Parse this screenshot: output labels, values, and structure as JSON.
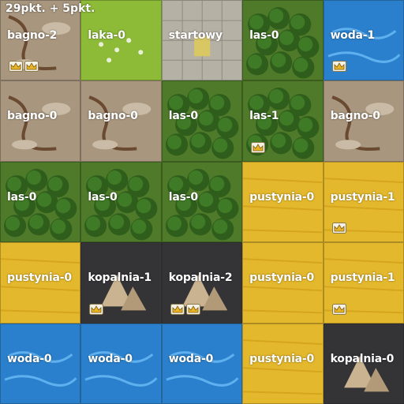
{
  "score": "29pkt. + 5pkt.",
  "colors": {
    "bagno": "#a89680",
    "laka": "#8fbd3a",
    "startowy": "#b9b4a8",
    "las": "#4f7a2a",
    "woda": "#2f86cf",
    "pustynia": "#e6bb2e",
    "kopalnia": "#3b3a3c"
  },
  "grid": [
    [
      {
        "label": "bagno-2",
        "terrain": "bagno",
        "crowns": 2
      },
      {
        "label": "laka-0",
        "terrain": "laka",
        "crowns": 0
      },
      {
        "label": "startowy",
        "terrain": "startowy",
        "crowns": 0
      },
      {
        "label": "las-0",
        "terrain": "las",
        "crowns": 0
      },
      {
        "label": "woda-1",
        "terrain": "woda",
        "crowns": 1
      }
    ],
    [
      {
        "label": "bagno-0",
        "terrain": "bagno",
        "crowns": 0
      },
      {
        "label": "bagno-0",
        "terrain": "bagno",
        "crowns": 0
      },
      {
        "label": "las-0",
        "terrain": "las",
        "crowns": 0
      },
      {
        "label": "las-1",
        "terrain": "las",
        "crowns": 1
      },
      {
        "label": "bagno-0",
        "terrain": "bagno",
        "crowns": 0
      }
    ],
    [
      {
        "label": "las-0",
        "terrain": "las",
        "crowns": 0
      },
      {
        "label": "las-0",
        "terrain": "las",
        "crowns": 0
      },
      {
        "label": "las-0",
        "terrain": "las",
        "crowns": 0
      },
      {
        "label": "pustynia-0",
        "terrain": "pustynia",
        "crowns": 0
      },
      {
        "label": "pustynia-1",
        "terrain": "pustynia",
        "crowns": 1
      }
    ],
    [
      {
        "label": "pustynia-0",
        "terrain": "pustynia",
        "crowns": 0
      },
      {
        "label": "kopalnia-1",
        "terrain": "kopalnia",
        "crowns": 1
      },
      {
        "label": "kopalnia-2",
        "terrain": "kopalnia",
        "crowns": 2
      },
      {
        "label": "pustynia-0",
        "terrain": "pustynia",
        "crowns": 0
      },
      {
        "label": "pustynia-1",
        "terrain": "pustynia",
        "crowns": 1
      }
    ],
    [
      {
        "label": "woda-0",
        "terrain": "woda",
        "crowns": 0
      },
      {
        "label": "woda-0",
        "terrain": "woda",
        "crowns": 0
      },
      {
        "label": "woda-0",
        "terrain": "woda",
        "crowns": 0
      },
      {
        "label": "pustynia-0",
        "terrain": "pustynia",
        "crowns": 0
      },
      {
        "label": "kopalnia-0",
        "terrain": "kopalnia",
        "crowns": 0
      }
    ]
  ]
}
